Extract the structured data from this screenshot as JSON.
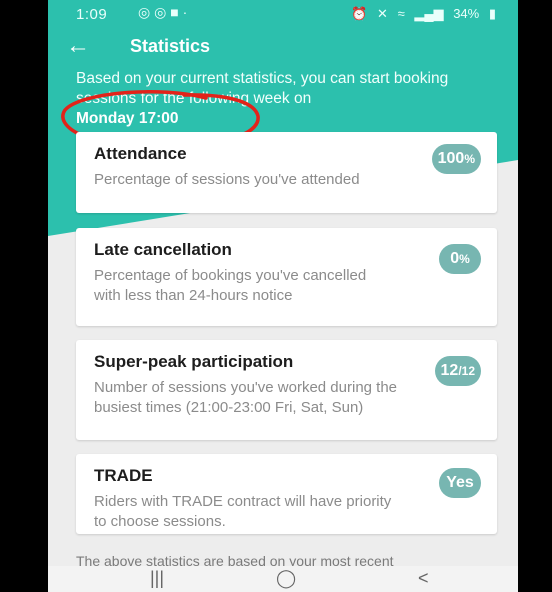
{
  "status_bar": {
    "time": "1:09",
    "battery": "34%"
  },
  "header": {
    "title": "Statistics"
  },
  "intro": {
    "text": "Based on your current statistics, you can start booking sessions for the following week on",
    "highlight": "Monday 17:00"
  },
  "cards": [
    {
      "title": "Attendance",
      "description": "Percentage of sessions you've attended",
      "badge_main": "100",
      "badge_suffix": "%"
    },
    {
      "title": "Late cancellation",
      "description": "Percentage of bookings you've cancelled with less than 24-hours notice",
      "badge_main": "0",
      "badge_suffix": "%"
    },
    {
      "title": "Super-peak participation",
      "description": "Number of sessions you've worked during the busiest times (21:00-23:00 Fri, Sat, Sun)",
      "badge_main": "12",
      "badge_suffix": "/12"
    },
    {
      "title": "TRADE",
      "description": "Riders with TRADE contract will have priority to choose sessions.",
      "badge_main": "Yes",
      "badge_suffix": ""
    }
  ],
  "footer_note": "The above statistics are based on your most recent",
  "nav": {
    "recents": "|||",
    "home": "◯",
    "back": "<"
  },
  "colors": {
    "accent": "#2cc0ad",
    "badge": "#77b6b1",
    "annotation": "#e2231a"
  },
  "icons": {
    "back": "arrow-left-icon",
    "wifi": "wifi-icon",
    "signal": "signal-icon",
    "battery": "battery-icon"
  }
}
